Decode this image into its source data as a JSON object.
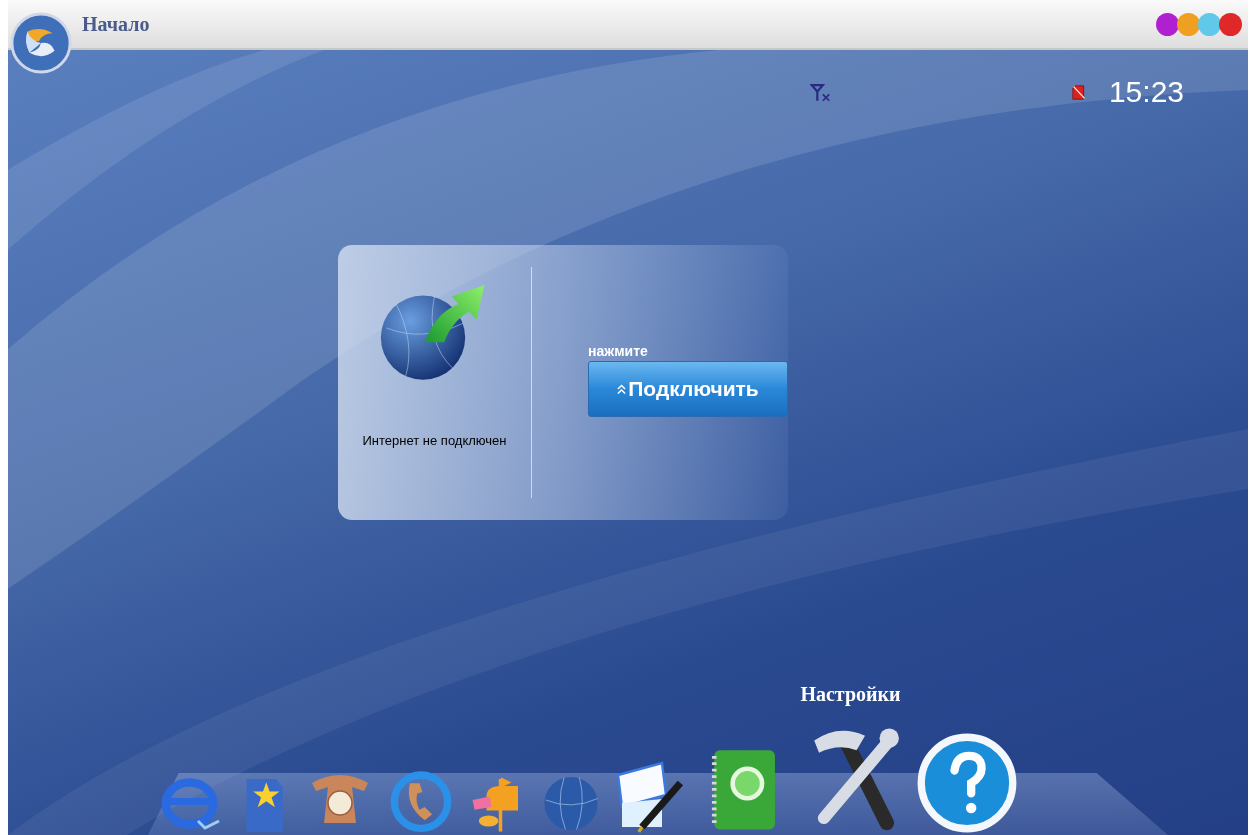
{
  "window": {
    "title": "Начало",
    "controls": [
      {
        "color": "#b020d0"
      },
      {
        "color": "#f0a020"
      },
      {
        "color": "#60c8e8"
      },
      {
        "color": "#e02828"
      }
    ]
  },
  "status": {
    "signal_connected": false,
    "sim_present": false,
    "time": "15:23"
  },
  "connection_panel": {
    "connected": false,
    "status_text": "Интернет не подключен",
    "hint": "нажмите",
    "button": "Подключить"
  },
  "dock": {
    "items": [
      {
        "kind": "browser",
        "hovered": false
      },
      {
        "kind": "favorites",
        "hovered": false
      },
      {
        "kind": "phone",
        "hovered": false
      },
      {
        "kind": "call",
        "hovered": false
      },
      {
        "kind": "mailbox",
        "hovered": false
      },
      {
        "kind": "globe",
        "hovered": false
      },
      {
        "kind": "note",
        "hovered": false
      },
      {
        "kind": "contacts",
        "hovered": false
      },
      {
        "kind": "settings",
        "hovered": true,
        "label": "Настройки"
      },
      {
        "kind": "help",
        "hovered": false
      }
    ]
  }
}
